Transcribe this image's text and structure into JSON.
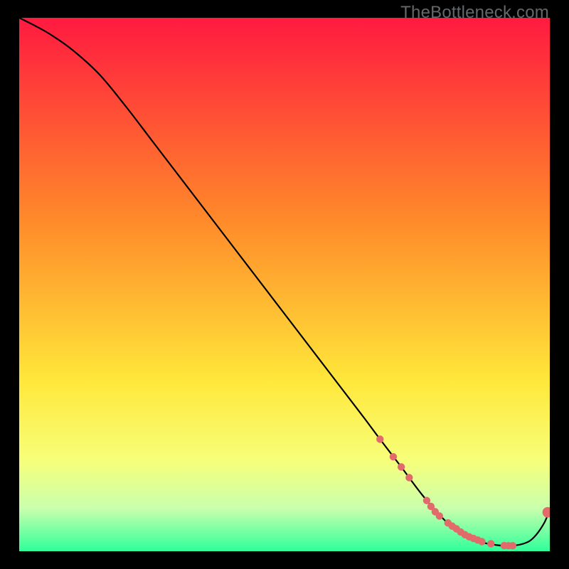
{
  "watermark": "TheBottleneck.com",
  "colors": {
    "line": "#000000",
    "marker": "#e26a6a",
    "grad_top": "#ff1a40",
    "grad_mid1": "#ff8a2a",
    "grad_mid2": "#ffe73a",
    "grad_low1": "#f7ff7a",
    "grad_low2": "#c9ffad",
    "grad_bot": "#2fff9a",
    "bg": "#000000"
  },
  "chart_data": {
    "type": "line",
    "title": "",
    "xlabel": "",
    "ylabel": "",
    "xlim": [
      0,
      100
    ],
    "ylim": [
      0,
      100
    ],
    "grid": false,
    "legend": false,
    "curve": {
      "x": [
        0,
        3,
        6,
        10,
        15,
        20,
        25,
        30,
        35,
        40,
        45,
        50,
        55,
        60,
        65,
        68,
        72,
        76,
        80,
        83,
        86,
        89,
        92,
        95,
        97,
        99,
        100
      ],
      "y": [
        100,
        98.5,
        96.8,
        94,
        89.5,
        83.5,
        77,
        70.5,
        64,
        57.5,
        51,
        44.5,
        38,
        31.5,
        25,
        21,
        15.8,
        10.5,
        6,
        3.5,
        2,
        1.3,
        1,
        1.4,
        2.6,
        5.4,
        8
      ]
    },
    "markers": {
      "x": [
        68,
        70.5,
        72,
        73.5,
        76.8,
        77.6,
        78.4,
        79.2,
        80.8,
        81.6,
        82.4,
        83.2,
        84.0,
        84.8,
        85.6,
        86.4,
        87.2,
        88.9,
        91.4,
        92.2,
        93.0,
        99.6
      ],
      "y": [
        21.0,
        17.7,
        15.8,
        13.8,
        9.5,
        8.4,
        7.4,
        6.6,
        5.3,
        4.7,
        4.2,
        3.6,
        3.1,
        2.7,
        2.4,
        2.1,
        1.8,
        1.4,
        1.05,
        1.02,
        1.02,
        7.3
      ],
      "r_small": 5.2,
      "r_large": 7.4,
      "large_idx": [
        21
      ]
    }
  }
}
